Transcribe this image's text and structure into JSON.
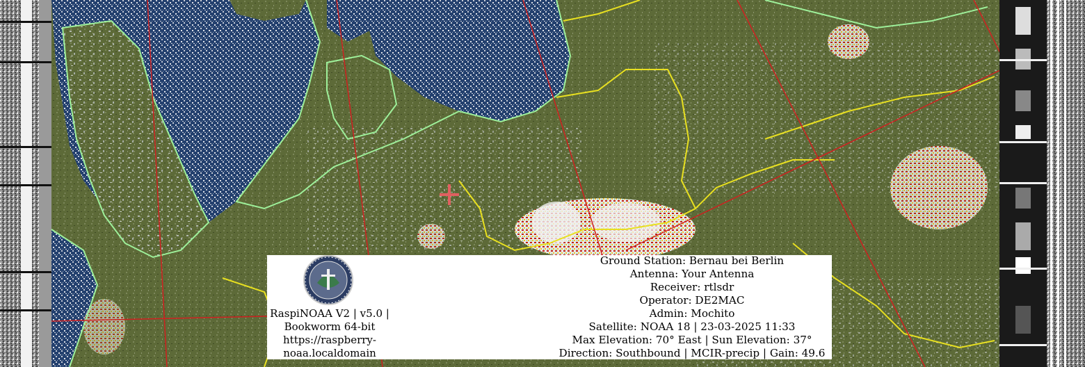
{
  "header": {
    "ground_station": "Ground Station: Bernau bei Berlin",
    "antenna": "Antenna: Your Antenna",
    "receiver": "Receiver: rtlsdr",
    "operator": "Operator: DE2MAC",
    "admin": "Admin: Mochito",
    "satellite": "Satellite: NOAA 18 | 23-03-2025 11:33",
    "elevation": "Max Elevation: 70° East | Sun Elevation: 37°",
    "direction": "Direction: Southbound | MCIR-precip | Gain: 49.6"
  },
  "software": {
    "line1": "RaspiNOAA V2 | v5.0 |",
    "line2": "Bookworm 64-bit",
    "line3": "https://raspberry-",
    "line4": "noaa.localdomain"
  },
  "logo": {
    "icon": "raspinoaa-logo"
  },
  "colors": {
    "land": "#5f6b3a",
    "sea": "#1c3a6a",
    "coastline": "#9ef09a",
    "border": "#e8e020",
    "grid": "#d02020",
    "marker": "#e06060"
  }
}
